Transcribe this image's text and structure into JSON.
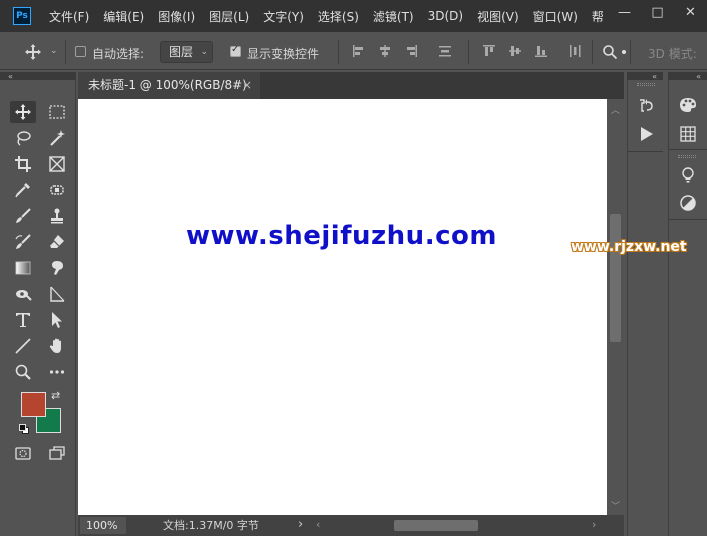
{
  "app": {
    "logo": "Ps"
  },
  "menu": [
    "文件(F)",
    "编辑(E)",
    "图像(I)",
    "图层(L)",
    "文字(Y)",
    "选择(S)",
    "滤镜(T)",
    "3D(D)",
    "视图(V)",
    "窗口(W)",
    "帮"
  ],
  "window_controls": {
    "minimize": "—",
    "maximize": "□",
    "close": "✕"
  },
  "options": {
    "auto_select_label": "自动选择:",
    "auto_select_checked": false,
    "layer_select_value": "图层",
    "show_transform_label": "显示变换控件",
    "show_transform_checked": true,
    "mode_3d_label": "3D 模式:"
  },
  "document": {
    "tab_title": "未标题-1 @ 100%(RGB/8#)",
    "tab_close": "×",
    "canvas_text": "www.shejifuzhu.com",
    "canvas_text_color": "#1010c8"
  },
  "status": {
    "zoom": "100%",
    "doc_info": "文档:1.37M/0 字节",
    "arrow": "›"
  },
  "colors": {
    "foreground": "#b5452f",
    "background": "#137a4c"
  },
  "watermark": "www.rjzxw.net"
}
